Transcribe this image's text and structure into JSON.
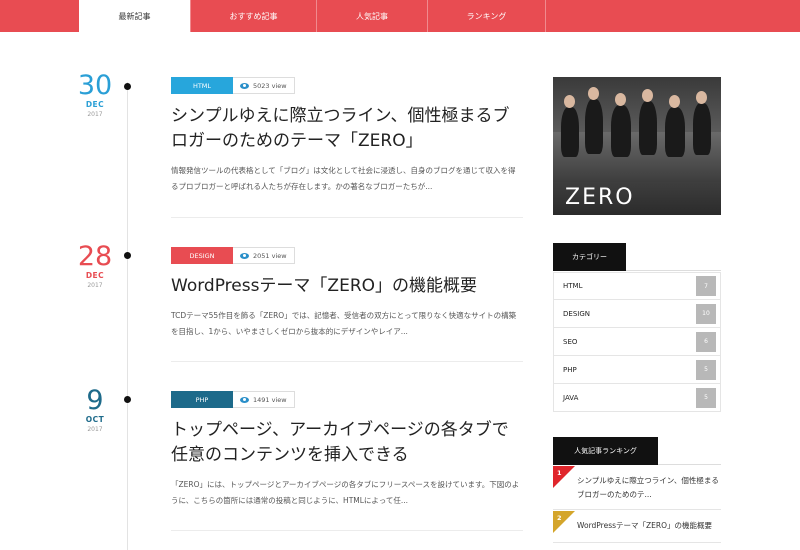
{
  "tabs": [
    {
      "label": "最新記事",
      "active": true
    },
    {
      "label": "おすすめ記事",
      "active": false
    },
    {
      "label": "人気記事",
      "active": false
    },
    {
      "label": "ランキング",
      "active": false
    }
  ],
  "posts": [
    {
      "day": "30",
      "month": "DEC",
      "year": "2017",
      "day_color": "#2a9fd6",
      "category": "HTML",
      "category_color": "#27a6dc",
      "views": "5023 view",
      "title": "シンプルゆえに際立つライン、個性極まるブロガーのためのテーマ「ZERO」",
      "excerpt": "情報発信ツールの代表格として「ブログ」は文化として社会に浸透し、自身のブログを通じて収入を得るプロブロガーと呼ばれる人たちが存在します。かの著名なブロガーたちが..."
    },
    {
      "day": "28",
      "month": "DEC",
      "year": "2017",
      "day_color": "#e84c52",
      "category": "DESIGN",
      "category_color": "#e84c52",
      "views": "2051 view",
      "title": "WordPressテーマ「ZERO」の機能概要",
      "excerpt": "TCDテーマ55作目を飾る「ZERO」では、記憶者、受信者の双方にとって限りなく快適なサイトの構築を目指し、1から、いやまさしくゼロから抜本的にデザインやレイア..."
    },
    {
      "day": "9",
      "month": "OCT",
      "year": "2017",
      "day_color": "#1d6a8a",
      "category": "PHP",
      "category_color": "#1d6a8a",
      "views": "1491 view",
      "title": "トップページ、アーカイブページの各タブで任意のコンテンツを挿入できる",
      "excerpt": "「ZERO」には、トップページとアーカイブページの各タブにフリースペースを設けています。下図のように、こちらの箇所には通常の投稿と同じように、HTMLによって任..."
    }
  ],
  "sidebar": {
    "banner_text": "ZERO",
    "category_heading": "カテゴリー",
    "categories": [
      {
        "name": "HTML",
        "count": "7"
      },
      {
        "name": "DESIGN",
        "count": "10"
      },
      {
        "name": "SEO",
        "count": "6"
      },
      {
        "name": "PHP",
        "count": "5"
      },
      {
        "name": "JAVA",
        "count": "5"
      }
    ],
    "ranking_heading": "人気記事ランキング",
    "ranking": [
      {
        "rank": "1",
        "color": "#e0262c",
        "title": "シンプルゆえに際立つライン、個性極まるブロガーのためのテ..."
      },
      {
        "rank": "2",
        "color": "#d4a52b",
        "title": "WordPressテーマ「ZERO」の機能概要"
      }
    ]
  }
}
